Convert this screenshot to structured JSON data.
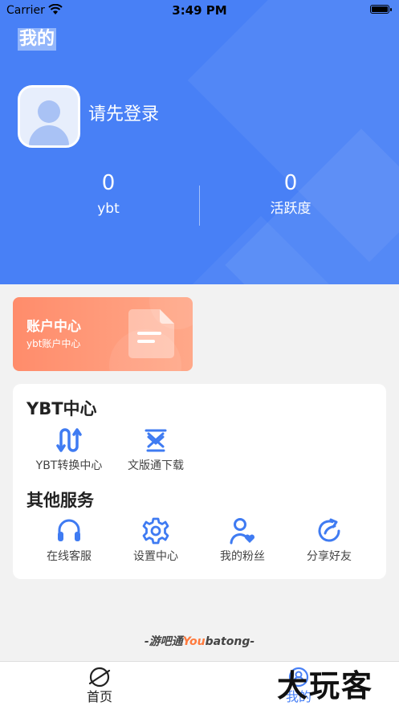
{
  "status_bar": {
    "carrier": "Carrier",
    "time": "3:49 PM"
  },
  "page_title": "我的",
  "profile": {
    "login_prompt": "请先登录"
  },
  "stats": [
    {
      "value": "0",
      "label": "ybt"
    },
    {
      "value": "0",
      "label": "活跃度"
    }
  ],
  "account_card": {
    "title": "账户中心",
    "subtitle": "ybt账户中心"
  },
  "ybt_center": {
    "title": "YBT中心",
    "items": [
      {
        "label": "YBT转换中心",
        "icon": "exchange-icon"
      },
      {
        "label": "文版通下载",
        "icon": "download-icon"
      }
    ]
  },
  "other_services": {
    "title": "其他服务",
    "items": [
      {
        "label": "在线客服",
        "icon": "headset-icon"
      },
      {
        "label": "设置中心",
        "icon": "gear-icon"
      },
      {
        "label": "我的粉丝",
        "icon": "user-heart-icon"
      },
      {
        "label": "分享好友",
        "icon": "share-icon"
      }
    ]
  },
  "brand": {
    "prefix": "-游吧通",
    "accent": "You",
    "suffix": "batong-"
  },
  "tabbar": {
    "items": [
      {
        "label": "首页",
        "icon": "planet-icon"
      },
      {
        "label": "我的",
        "icon": "user-icon"
      }
    ]
  },
  "watermark": "大玩客",
  "colors": {
    "primary": "#4880f6",
    "accent_orange": "#ff8c6b",
    "brand_orange": "#ff7a3d"
  }
}
